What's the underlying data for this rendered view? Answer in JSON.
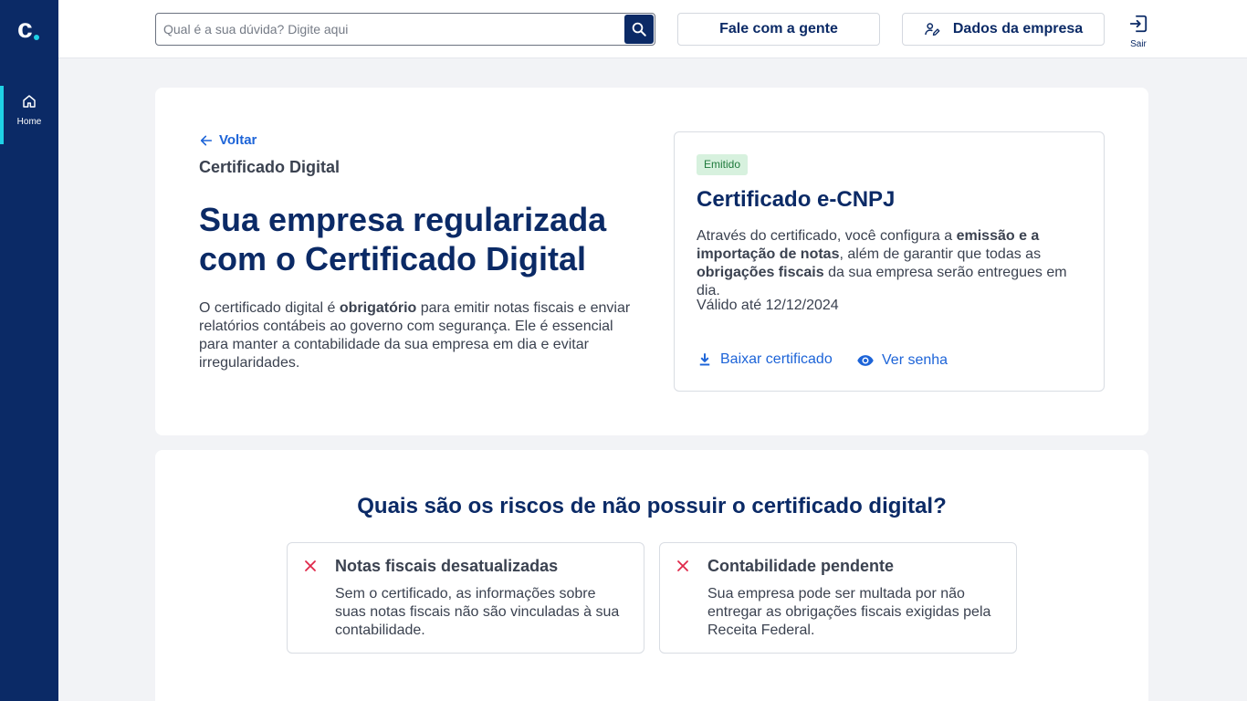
{
  "colors": {
    "navy": "#0b2a66",
    "accent_cyan": "#1fd2e6",
    "link_blue": "#1d64d8",
    "badge_green_bg": "#d7f1de",
    "error_red": "#e0284a"
  },
  "sidebar": {
    "logo_letter": "c",
    "items": [
      {
        "label": "Home",
        "icon": "home-icon",
        "active": true
      }
    ]
  },
  "header": {
    "search_placeholder": "Qual é a sua dúvida? Digite aqui",
    "search_value": "",
    "fale_label": "Fale com a gente",
    "dados_label": "Dados da empresa",
    "sair_label": "Sair"
  },
  "main": {
    "back_label": "Voltar",
    "breadcrumb": "Certificado Digital",
    "headline": "Sua empresa regularizada com o Certificado Digital",
    "intro": {
      "part1": "O certificado digital é ",
      "bold1": "obrigatório",
      "part2": " para emitir notas fiscais e enviar relatórios contábeis ao governo com segurança. Ele é essencial para manter a contabilidade da sua empresa em dia e evitar irregularidades."
    },
    "certificate": {
      "status": "Emitido",
      "title": "Certificado e-CNPJ",
      "desc1": "Através do certificado, você configura a ",
      "bold1": "emissão e a importação de notas",
      "desc2": ", além de garantir que todas as ",
      "bold2": "obrigações fiscais",
      "desc3": " da sua empresa serão entregues em dia.",
      "validity": "Válido até 12/12/2024",
      "download_label": "Baixar certificado",
      "password_label": "Ver senha"
    }
  },
  "risks": {
    "title": "Quais são os riscos de não possuir o certificado digital?",
    "items": [
      {
        "title": "Notas fiscais desatualizadas",
        "desc": "Sem o certificado, as informações sobre suas notas fiscais não são vinculadas à sua contabilidade."
      },
      {
        "title": "Contabilidade pendente",
        "desc": "Sua empresa pode ser multada por não entregar as obrigações fiscais exigidas pela Receita Federal."
      }
    ]
  }
}
